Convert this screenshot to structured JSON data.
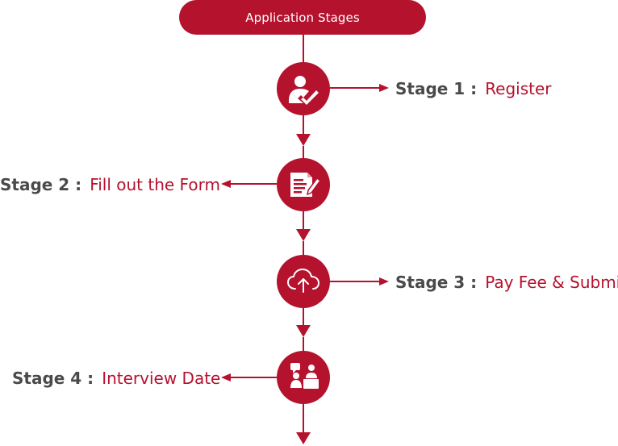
{
  "header": {
    "title": "Application Stages"
  },
  "colors": {
    "accent": "#b5122e",
    "prefix_text": "#4a4a4a",
    "icon_glyph": "#ffffff"
  },
  "stages": [
    {
      "prefix": "Stage 1 :",
      "name": "Register",
      "icon": "user-check-icon",
      "side": "right"
    },
    {
      "prefix": "Stage 2 :",
      "name": "Fill out the Form",
      "icon": "form-edit-icon",
      "side": "left"
    },
    {
      "prefix": "Stage 3 :",
      "name": "Pay Fee & Submit",
      "icon": "cloud-upload-icon",
      "side": "right"
    },
    {
      "prefix": "Stage 4 :",
      "name": "Interview Date",
      "icon": "interview-icon",
      "side": "left"
    }
  ]
}
